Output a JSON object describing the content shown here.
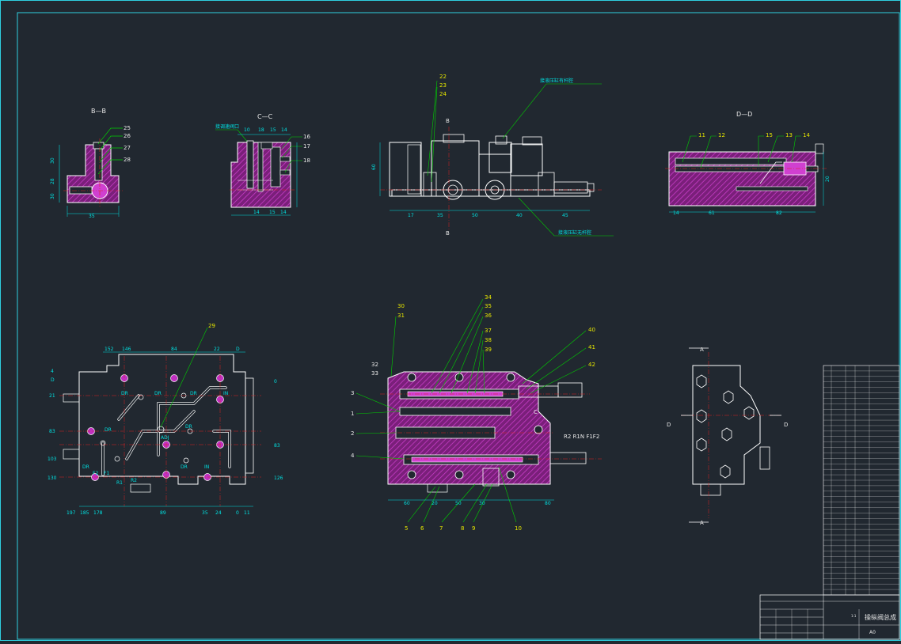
{
  "colors": {
    "background": "#212830",
    "border": "#2fd0e0",
    "outline": "#ffffff",
    "hatch": "#c030c0",
    "dimension": "#00e0e0",
    "leader": "#00d000",
    "centerline": "#e02020",
    "label_yellow": "#e6e600"
  },
  "views": {
    "bb": {
      "title": "B—B",
      "labels": [
        "25",
        "26",
        "27",
        "28"
      ],
      "dims": [
        "35",
        "30",
        "28",
        "30"
      ]
    },
    "cc": {
      "title": "C—C",
      "note": "接调速阀口",
      "labels": [
        "16",
        "17",
        "18"
      ],
      "dims_top": [
        "10",
        "18",
        "15",
        "14"
      ],
      "dims_bottom": [
        "14",
        "15",
        "14"
      ]
    },
    "front": {
      "labels": [
        "22",
        "23",
        "24"
      ],
      "section_mark": "B",
      "note_top": "接液压缸有杆腔",
      "note_bottom": "接液压缸无杆腔",
      "dims": [
        "17",
        "35",
        "50",
        "40",
        "45"
      ],
      "dim_height": "60"
    },
    "dd": {
      "title": "D—D",
      "labels": [
        "11",
        "12",
        "15",
        "13",
        "14"
      ],
      "dims": [
        "14",
        "61",
        "82"
      ],
      "dim_height": "20"
    },
    "plan": {
      "label": "29",
      "top_dims": [
        "152",
        "146",
        "84",
        "22"
      ],
      "bottom_dims": [
        "197",
        "185",
        "178",
        "89",
        "35",
        "24",
        "0",
        "11"
      ],
      "left_dims": [
        "4",
        "D",
        "21",
        "83",
        "103",
        "130"
      ],
      "right_dims": [
        "D",
        "0",
        "83",
        "126"
      ],
      "ports": [
        "DR",
        "DR",
        "DR",
        "IN",
        "DR",
        "ADJ",
        "DR",
        "DR",
        "F2",
        "F1",
        "R1",
        "R2",
        "DR",
        "IN"
      ]
    },
    "section": {
      "top_labels": [
        "30",
        "31",
        "32",
        "33",
        "34",
        "35",
        "36",
        "37",
        "38",
        "39"
      ],
      "right_labels": [
        "40",
        "41",
        "42"
      ],
      "left_labels": [
        "3",
        "1",
        "2",
        "4"
      ],
      "bottom_labels": [
        "5",
        "6",
        "7",
        "8",
        "9",
        "10"
      ],
      "ports": "R2 R1N F1F2",
      "letter_c": "C",
      "dims": [
        "60",
        "20",
        "50",
        "30",
        "80"
      ]
    },
    "side": {
      "mark_top": "A",
      "mark_bottom": "A",
      "mark_left": "D",
      "mark_right": "D"
    }
  },
  "title_block": {
    "drawing_title": "操纵阀总成",
    "sheet_size": "A0",
    "scale": "1:1"
  }
}
